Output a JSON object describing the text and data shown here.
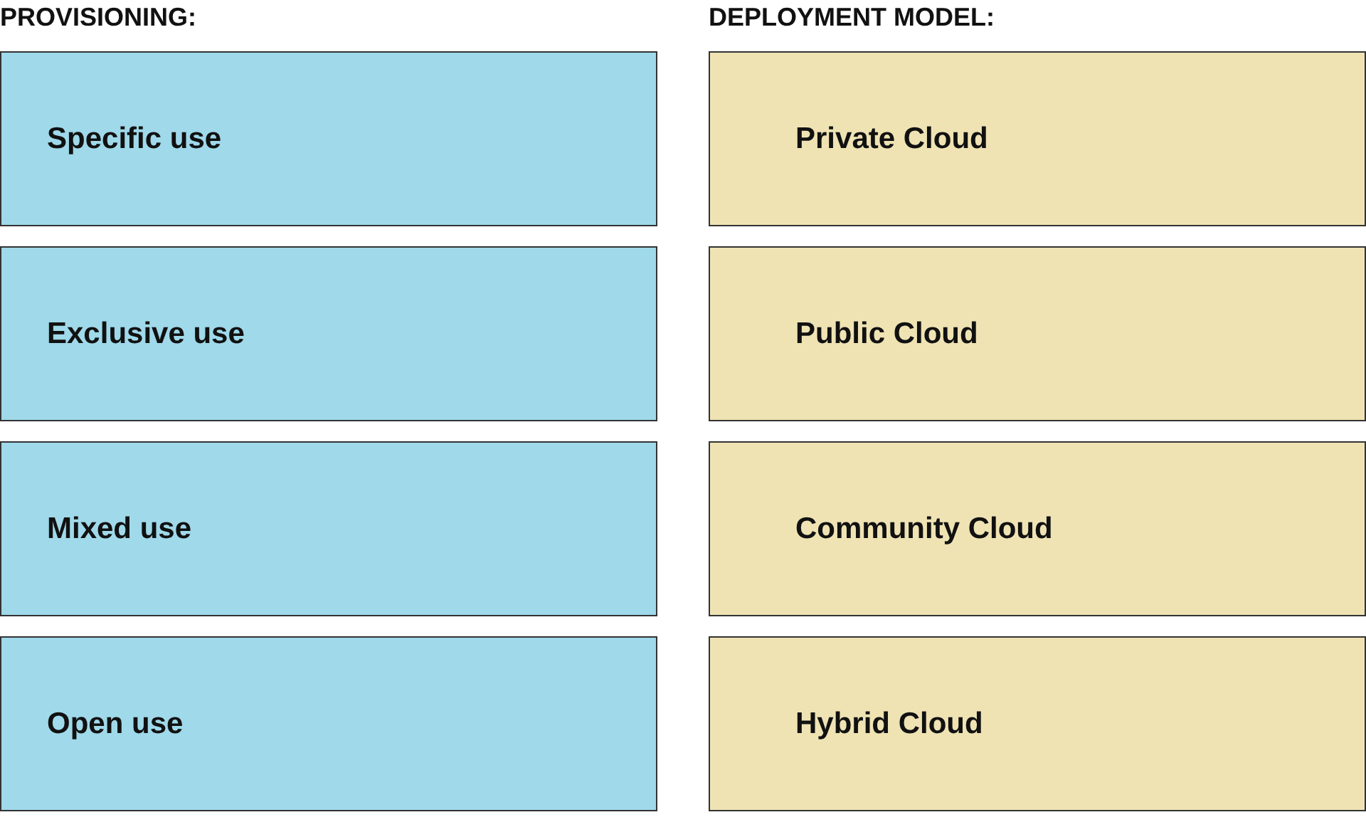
{
  "columns": [
    {
      "heading": "PROVISIONING:",
      "color": "#9fd9ea",
      "items": [
        "Specific use",
        "Exclusive use",
        "Mixed use",
        "Open use"
      ]
    },
    {
      "heading": "DEPLOYMENT MODEL:",
      "color": "#efe3b4",
      "items": [
        "Private Cloud",
        "Public Cloud",
        "Community Cloud",
        "Hybrid Cloud"
      ]
    }
  ]
}
